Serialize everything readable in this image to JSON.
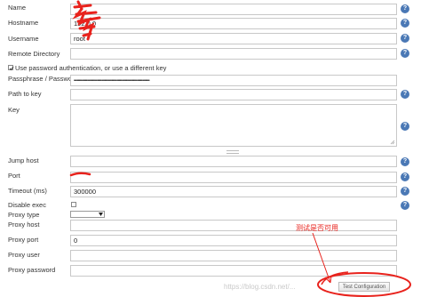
{
  "form": {
    "name": {
      "label": "Name",
      "value": ""
    },
    "hostname": {
      "label": "Hostname",
      "value": "192.0.0"
    },
    "username": {
      "label": "Username",
      "value": "root"
    },
    "remote_directory": {
      "label": "Remote Directory",
      "value": ""
    },
    "use_password": {
      "label": "Use password authentication, or use a different key",
      "checked": true
    },
    "passphrase": {
      "label": "Passphrase / Password",
      "value": "••••••••••••••••••••••••••••••••••••••••••••••••••••••••••••••••••••••••••"
    },
    "path_to_key": {
      "label": "Path to key",
      "value": ""
    },
    "key": {
      "label": "Key",
      "value": ""
    },
    "jump_host": {
      "label": "Jump host",
      "value": ""
    },
    "port": {
      "label": "Port",
      "value": ""
    },
    "timeout": {
      "label": "Timeout (ms)",
      "value": "300000"
    },
    "disable_exec": {
      "label": "Disable exec",
      "checked": false
    },
    "proxy_type": {
      "label": "Proxy type",
      "value": ""
    },
    "proxy_host": {
      "label": "Proxy host",
      "value": ""
    },
    "proxy_port": {
      "label": "Proxy port",
      "value": "0"
    },
    "proxy_user": {
      "label": "Proxy user",
      "value": ""
    },
    "proxy_password": {
      "label": "Proxy password",
      "value": ""
    }
  },
  "help_glyph": "?",
  "buttons": {
    "test_configuration": "Test Configuration"
  },
  "annotation": {
    "text": "测试是否可用",
    "color": "#e8221c"
  },
  "watermark": "https://blog.csdn.net/..."
}
